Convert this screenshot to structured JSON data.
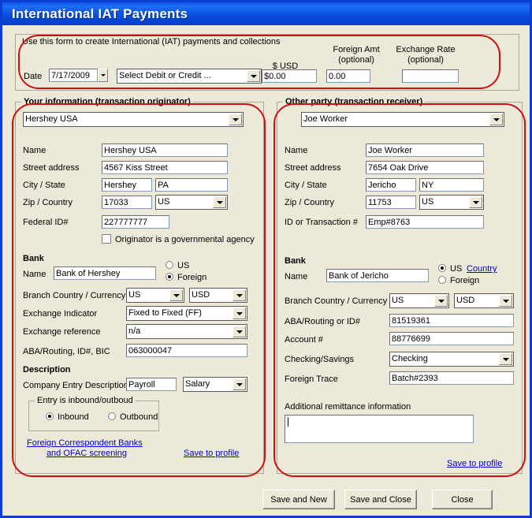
{
  "window": {
    "title": "International IAT Payments"
  },
  "header": {
    "instruction": "Use this form to create International (IAT) payments and collections",
    "date_label": "Date",
    "date_value": "7/17/2009",
    "type_value": "Select Debit or Credit ...",
    "usd_label": "$ USD",
    "usd_value": "$0.00",
    "foreign_amt_label_1": "Foreign Amt",
    "foreign_amt_label_2": "(optional)",
    "foreign_amt_value": "0.00",
    "exchange_rate_label_1": "Exchange Rate",
    "exchange_rate_label_2": "(optional)",
    "exchange_rate_value": ""
  },
  "originator": {
    "group_title": "Your information (transaction originator)",
    "profile_value": "Hershey USA",
    "name_label": "Name",
    "name_value": "Hershey USA",
    "street_label": "Street address",
    "street_value": "4567 Kiss Street",
    "city_state_label": "City / State",
    "city_value": "Hershey",
    "state_value": "PA",
    "zip_country_label": "Zip / Country",
    "zip_value": "17033",
    "country_value": "US",
    "federal_id_label": "Federal ID#",
    "federal_id_value": "227777777",
    "gov_agency_label": "Originator is a governmental agency",
    "bank_header": "Bank",
    "bank_name_label": "Name",
    "bank_name_value": "Bank of Hershey",
    "radio_us": "US",
    "radio_foreign": "Foreign",
    "radio_selected": "Foreign",
    "branch_label": "Branch Country / Currency",
    "branch_country_value": "US",
    "branch_currency_value": "USD",
    "exchange_indicator_label": "Exchange Indicator",
    "exchange_indicator_value": "Fixed to Fixed (FF)",
    "exchange_reference_label": "Exchange reference",
    "exchange_reference_value": "n/a",
    "aba_label": "ABA/Routing, ID#, BIC",
    "aba_value": "063000047",
    "description_header": "Description",
    "company_entry_label": "Company Entry Description",
    "company_entry_value": "Payroll",
    "company_entry_type": "Salary",
    "inout_group_title": "Entry is inbound/outboud",
    "inbound_label": "Inbound",
    "outbound_label": "Outbound",
    "inout_selected": "Inbound",
    "fcb_link_line1": "Foreign Correspondent Banks",
    "fcb_link_line2": "and OFAC screening",
    "save_profile_link": "Save to profile"
  },
  "receiver": {
    "group_title": "Other party (transaction receiver)",
    "profile_value": "Joe Worker",
    "name_label": "Name",
    "name_value": "Joe Worker",
    "street_label": "Street address",
    "street_value": "7654 Oak Drive",
    "city_state_label": "City / State",
    "city_value": "Jericho",
    "state_value": "NY",
    "zip_country_label": "Zip / Country",
    "zip_value": "11753",
    "country_value": "US",
    "id_transaction_label": "ID or Transaction #",
    "id_transaction_value": "Emp#8763",
    "bank_header": "Bank",
    "bank_name_label": "Name",
    "bank_name_value": "Bank of Jericho",
    "radio_us": "US",
    "radio_foreign": "Foreign",
    "radio_selected": "US",
    "country_link": "Country",
    "branch_label": "Branch Country / Currency",
    "branch_country_value": "US",
    "branch_currency_value": "USD",
    "aba_label": "ABA/Routing or ID#",
    "aba_value": "81519361",
    "account_label": "Account #",
    "account_value": "88776699",
    "checking_savings_label": "Checking/Savings",
    "checking_savings_value": "Checking",
    "foreign_trace_label": "Foreign Trace",
    "foreign_trace_value": "Batch#2393",
    "remittance_label": "Additional remittance information",
    "remittance_value": "",
    "save_profile_link": "Save to profile"
  },
  "footer": {
    "save_new": "Save and New",
    "save_close": "Save and Close",
    "close": "Close"
  },
  "colors": {
    "titlebar_blue": "#0a4fdf",
    "window_border": "#0a3fd0",
    "face": "#ece9d8",
    "annotation_red": "#cc1111",
    "link_blue": "#0000cc"
  }
}
